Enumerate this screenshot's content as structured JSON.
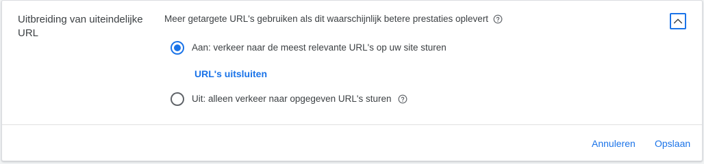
{
  "section": {
    "title": "Uitbreiding van uiteindelijke URL",
    "description": "Meer getargete URL's gebruiken als dit waarschijnlijk betere prestaties oplevert"
  },
  "options": {
    "on": {
      "label": "Aan: verkeer naar de meest relevante URL's op uw site sturen",
      "selected": true
    },
    "off": {
      "label": "Uit: alleen verkeer naar opgegeven URL's sturen",
      "selected": false
    }
  },
  "exclude_link": "URL's uitsluiten",
  "actions": {
    "cancel": "Annuleren",
    "save": "Opslaan"
  },
  "icons": {
    "help": "help-circle-icon",
    "collapse": "chevron-up-icon"
  },
  "colors": {
    "accent": "#1a73e8",
    "text": "#3c4043",
    "icon_gray": "#5f6368"
  }
}
